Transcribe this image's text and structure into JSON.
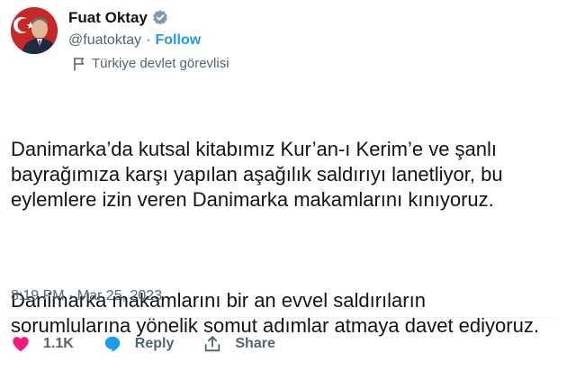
{
  "author": {
    "name": "Fuat Oktay",
    "handle": "@fuatoktay",
    "separator": "·",
    "follow_label": "Follow",
    "account_label": "Türkiye devlet görevlisi"
  },
  "tweet": {
    "paragraphs": [
      "Danimarka’da kutsal kitabımız Kur’an-ı Kerim’e ve şanlı bayrağımıza karşı yapılan aşağılık saldırıyı lanetliyor, bu eylemlere izin veren Danimarka makamlarını kınıyoruz.",
      "Danimarka makamlarını bir an evvel saldırıların sorumlularına yönelik somut adımlar atmaya davet ediyoruz."
    ],
    "timestamp": "8:19 PM · Mar 25, 2023"
  },
  "actions": {
    "like_count": "1.1K",
    "reply_label": "Reply",
    "share_label": "Share"
  },
  "colors": {
    "text": "#0f1419",
    "muted": "#536471",
    "accent": "#1d9bf0",
    "like": "#f91880",
    "verified_badge": "#829aab"
  },
  "icons": {
    "verified": "verified-badge-icon",
    "label": "government-flag-icon",
    "like": "heart-icon",
    "reply": "reply-bubble-icon",
    "share": "share-upload-icon"
  }
}
